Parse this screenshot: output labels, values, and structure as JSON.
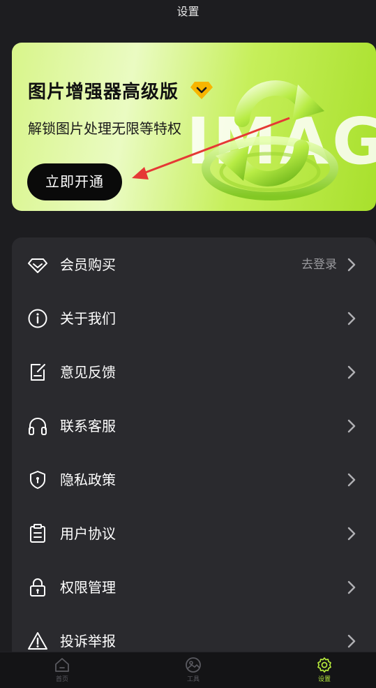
{
  "header": {
    "title": "设置"
  },
  "banner": {
    "title": "图片增强器高级版",
    "subtitle": "解锁图片处理无限等特权",
    "button_label": "立即开通",
    "image_word": "IMAGE",
    "colors": {
      "accent": "#b6ea3c",
      "button_bg": "#0a0a0a",
      "badge": "#f7b500",
      "arrow": "#e53935"
    }
  },
  "menu": {
    "items": [
      {
        "icon": "diamond-icon",
        "label": "会员购买",
        "right_text": "去登录"
      },
      {
        "icon": "info-icon",
        "label": "关于我们"
      },
      {
        "icon": "edit-note-icon",
        "label": "意见反馈"
      },
      {
        "icon": "headphones-icon",
        "label": "联系客服"
      },
      {
        "icon": "shield-icon",
        "label": "隐私政策"
      },
      {
        "icon": "clipboard-icon",
        "label": "用户协议"
      },
      {
        "icon": "lock-icon",
        "label": "权限管理"
      },
      {
        "icon": "warning-icon",
        "label": "投诉举报"
      }
    ]
  },
  "bottom_nav": {
    "items": [
      {
        "icon": "home-icon",
        "label": "首页",
        "active": false
      },
      {
        "icon": "image-tool-icon",
        "label": "工具",
        "active": false
      },
      {
        "icon": "settings-icon",
        "label": "设置",
        "active": true
      }
    ],
    "active_color": "#b6ea3c",
    "inactive_color": "#5a5a60"
  }
}
